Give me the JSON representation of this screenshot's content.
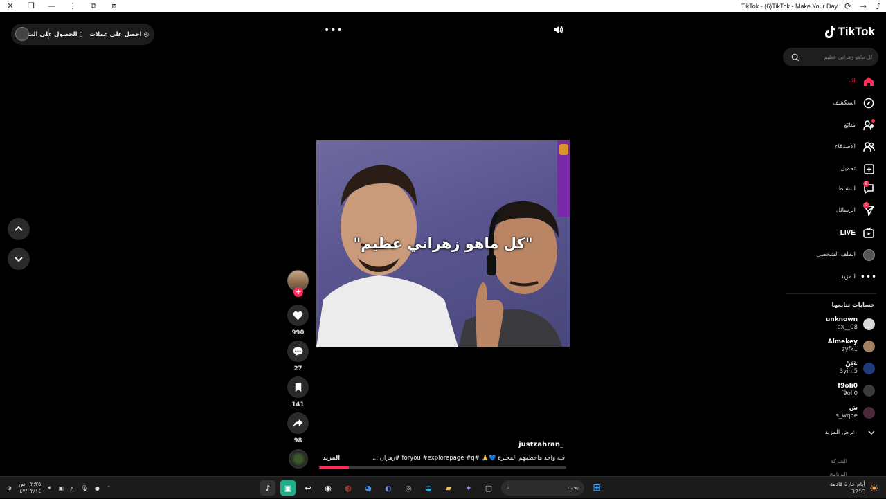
{
  "titlebar": {
    "title": "TikTok - (6)TikTok - Make Your Day"
  },
  "coins_pill": {
    "get_coins": "احصل على عملات",
    "get_app": "الحصول على الت..."
  },
  "video": {
    "overlay_caption": "\"كل ماهو زهراني عظيم\"",
    "author": "justzahran_",
    "description": "فيه واحد ماحطيتهم المحترة 💙🙏 #foryou #explorepage #q #زهران ...",
    "more_label": "المزيد",
    "progress_fraction": 0.12
  },
  "actions": {
    "likes": "990",
    "comments": "27",
    "saves": "141",
    "shares": "98"
  },
  "sidebar": {
    "logo": "TikTok",
    "search_placeholder": "كل ماهو زهراني عظيم",
    "nav": [
      {
        "label": "لك",
        "icon": "home-icon",
        "active": true
      },
      {
        "label": "استكشف",
        "icon": "compass-icon"
      },
      {
        "label": "متابَع",
        "icon": "following-icon"
      },
      {
        "label": "الأصدقاء",
        "icon": "friends-icon"
      },
      {
        "label": "تحميل",
        "icon": "upload-icon"
      },
      {
        "label": "النشاط",
        "icon": "activity-icon",
        "badge": "6"
      },
      {
        "label": "الرسائل",
        "icon": "messages-icon",
        "badge": "2"
      },
      {
        "label": "LIVE",
        "icon": "live-icon"
      },
      {
        "label": "الملف الشخصي",
        "icon": "profile-icon"
      },
      {
        "label": "المزيد",
        "icon": "more-icon"
      }
    ],
    "following_title": "حسابات تتابعها",
    "following": [
      {
        "name": "unknown",
        "handle": "bx__08"
      },
      {
        "name": "Almekey",
        "handle": "zyfk1"
      },
      {
        "name": "عَيَنْ",
        "handle": "3yin.5"
      },
      {
        "name": "f9oli0",
        "handle": "f9oli0"
      },
      {
        "name": "ش",
        "handle": "s_wqoe"
      }
    ],
    "see_more": "عرض المزيد",
    "footer": [
      "الشركة",
      "البرنامج"
    ]
  },
  "taskbar": {
    "time": "٠٢:٣٥ ص",
    "date": "٤٧/٠٢/١٤",
    "lang": "ع",
    "search_label": "بحث",
    "weather_text": "أيام حارة قادمة",
    "temperature": "32°C"
  },
  "colors": {
    "accent": "#fe2c55",
    "background": "#000000"
  }
}
